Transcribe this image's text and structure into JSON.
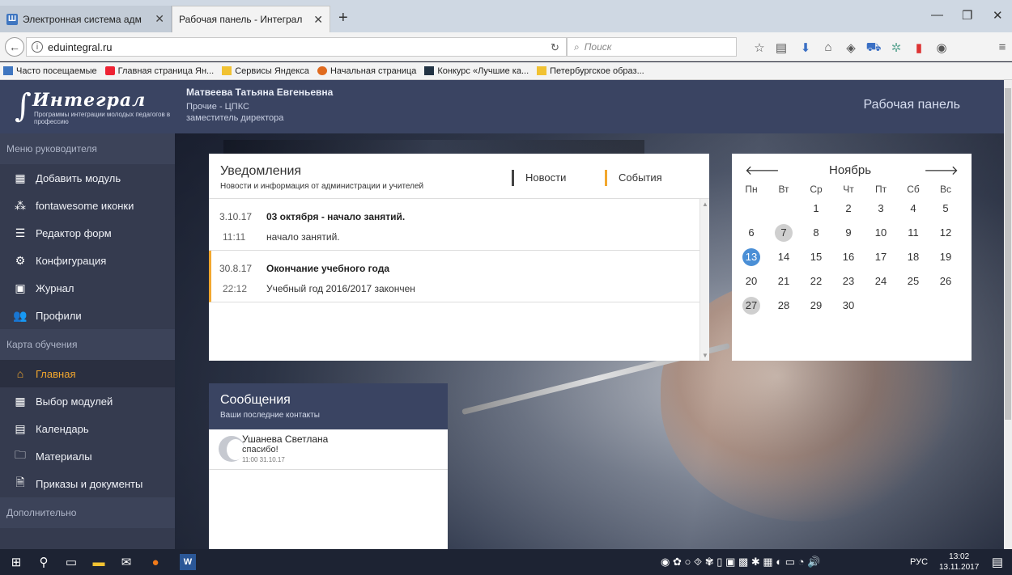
{
  "browser": {
    "tabs": [
      {
        "label": "Электронная система адм",
        "active": false
      },
      {
        "label": "Рабочая панель - Интеграл",
        "active": true
      }
    ],
    "url": "eduintegral.ru",
    "search_placeholder": "Поиск",
    "bookmarks": [
      {
        "label": "Часто посещаемые",
        "icon": "blue-bookmark-icon"
      },
      {
        "label": "Главная страница Ян...",
        "icon": "yandex-icon"
      },
      {
        "label": "Сервисы Яндекса",
        "icon": "folder-icon"
      },
      {
        "label": "Начальная страница",
        "icon": "yandex-browser-icon"
      },
      {
        "label": "Конкурс «Лучшие ка...",
        "icon": "page-icon"
      },
      {
        "label": "Петербургское образ...",
        "icon": "folder-icon"
      }
    ]
  },
  "header": {
    "logo_title": "Интеграл",
    "logo_subtitle": "Программы интеграции молодых педагогов в профессию",
    "user_name": "Матвеева Татьяна Евгеньевна",
    "user_org": "Прочие - ЦПКС",
    "user_role": "заместитель директора",
    "page_title": "Рабочая панель"
  },
  "sidebar": {
    "sections": [
      {
        "title": "Меню руководителя",
        "items": [
          {
            "label": "Добавить модуль",
            "icon": "grid-icon",
            "glyph": "▦"
          },
          {
            "label": "fontawesome иконки",
            "icon": "fontawesome-icon",
            "glyph": "⁂"
          },
          {
            "label": "Редактор форм",
            "icon": "list-icon",
            "glyph": "☰"
          },
          {
            "label": "Конфигурация",
            "icon": "gears-icon",
            "glyph": "⚙"
          },
          {
            "label": "Журнал",
            "icon": "journal-icon",
            "glyph": "▣"
          },
          {
            "label": "Профили",
            "icon": "users-icon",
            "glyph": "👥"
          }
        ]
      },
      {
        "title": "Карта обучения",
        "items": [
          {
            "label": "Главная",
            "icon": "home-icon",
            "glyph": "⌂",
            "active": true
          },
          {
            "label": "Выбор модулей",
            "icon": "grid-icon",
            "glyph": "▦"
          },
          {
            "label": "Календарь",
            "icon": "calendar-icon",
            "glyph": "▤"
          },
          {
            "label": "Материалы",
            "icon": "folder-open-icon",
            "glyph": "🗀"
          },
          {
            "label": "Приказы и документы",
            "icon": "document-icon",
            "glyph": "🗎"
          }
        ]
      },
      {
        "title": "Дополнительно",
        "items": []
      }
    ]
  },
  "notifications": {
    "title": "Уведомления",
    "subtitle": "Новости и информация от администрации и учителей",
    "tab_news": "Новости",
    "tab_events": "События",
    "items": [
      {
        "date": "3.10.17",
        "title": "03 октября - начало занятий.",
        "time": "11:11",
        "text": "начало занятий."
      },
      {
        "date": "30.8.17",
        "title": "Окончание учебного года",
        "time": "22:12",
        "text": "Учебный год 2016/2017 закончен"
      }
    ]
  },
  "calendar": {
    "month": "Ноябрь",
    "weekdays": [
      "Пн",
      "Вт",
      "Ср",
      "Чт",
      "Пт",
      "Сб",
      "Вс"
    ],
    "weeks": [
      [
        "",
        "",
        "1",
        "2",
        "3",
        "4",
        "5"
      ],
      [
        "6",
        "7",
        "8",
        "9",
        "10",
        "11",
        "12"
      ],
      [
        "13",
        "14",
        "15",
        "16",
        "17",
        "18",
        "19"
      ],
      [
        "20",
        "21",
        "22",
        "23",
        "24",
        "25",
        "26"
      ],
      [
        "27",
        "28",
        "29",
        "30",
        "",
        "",
        ""
      ]
    ],
    "today": "13",
    "marked": [
      "7",
      "27"
    ]
  },
  "messages": {
    "title": "Сообщения",
    "subtitle": "Ваши последние контакты",
    "items": [
      {
        "name": "Ушанева Светлана",
        "text": "спасибо!",
        "time": "11:00 31.10.17"
      }
    ]
  },
  "taskbar": {
    "language": "РУС",
    "time": "13:02",
    "date": "13.11.2017"
  },
  "colors": {
    "header_bg": "#3a4462",
    "sidebar_bg": "#353b4f",
    "accent_orange": "#f2a72e",
    "today_blue": "#4a8fd6"
  }
}
